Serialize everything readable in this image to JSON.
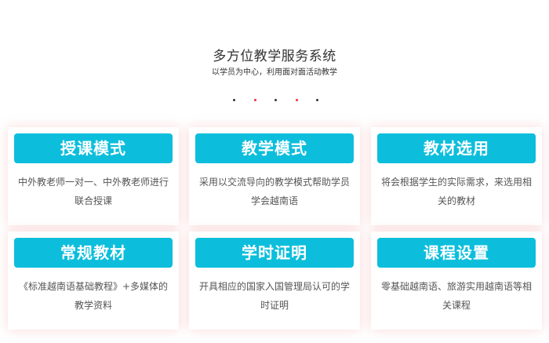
{
  "header": {
    "title": "多方位教学服务系统",
    "subtitle": "以学员为中心，利用面对面活动教学"
  },
  "dots": [
    {
      "color": "#333333"
    },
    {
      "color": "#e8323c"
    },
    {
      "color": "#333333"
    },
    {
      "color": "#e8323c"
    },
    {
      "color": "#333333"
    }
  ],
  "cards": [
    {
      "title": "授课模式",
      "desc": "中外教老师一对一、中外教老师进行联合授课"
    },
    {
      "title": "教学模式",
      "desc": "采用以交流导向的教学模式帮助学员学会越南语"
    },
    {
      "title": "教材选用",
      "desc": "将会根据学生的实际需求，来选用相关的教材"
    },
    {
      "title": "常规教材",
      "desc": "《标准越南语基础教程》+多媒体的教学资料"
    },
    {
      "title": "学时证明",
      "desc": "开具相应的国家入国管理局认可的学时证明"
    },
    {
      "title": "课程设置",
      "desc": "零基础越南语、旅游实用越南语等相关课程"
    }
  ],
  "colors": {
    "accent": "#0cbedc",
    "dot_red": "#e8323c"
  }
}
